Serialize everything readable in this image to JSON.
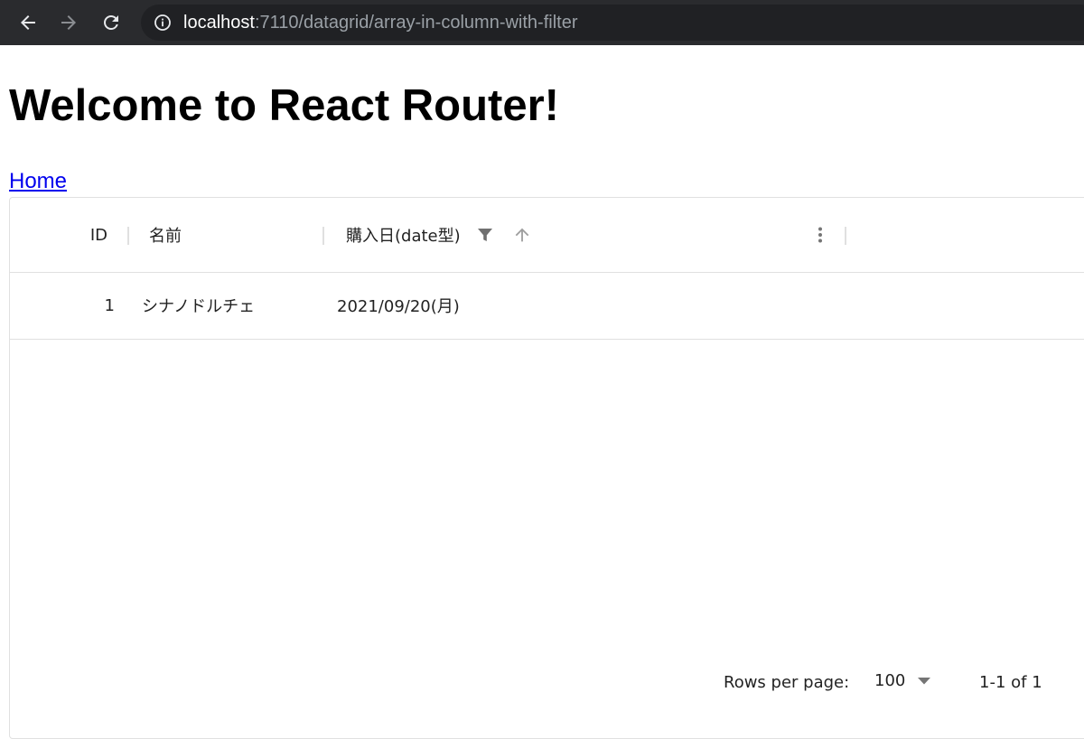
{
  "browser": {
    "url_host": "localhost",
    "url_rest": ":7110/datagrid/array-in-column-with-filter"
  },
  "page": {
    "title": "Welcome to React Router!",
    "home_link": "Home"
  },
  "grid": {
    "columns": [
      {
        "label": "ID"
      },
      {
        "label": "名前"
      },
      {
        "label": "購入日(date型)"
      }
    ],
    "rows": [
      {
        "id": "1",
        "name": "シナノドルチェ",
        "date": "2021/09/20(月)"
      }
    ],
    "footer": {
      "rows_per_page_label": "Rows per page:",
      "rows_per_page_value": "100",
      "page_range": "1-1 of 1"
    }
  },
  "icons": {
    "back": "arrow-left-icon",
    "forward": "arrow-right-icon",
    "reload": "reload-icon",
    "site_info": "info-icon",
    "filter": "filter-icon",
    "sort": "sort-ascending-icon",
    "column_menu": "more-vertical-icon",
    "select_dropdown": "caret-down-icon"
  },
  "colors": {
    "chrome_bg": "#2a2b2e",
    "omnibox_bg": "#202124",
    "link": "#0000ee",
    "grid_border": "#e0e0e0"
  }
}
